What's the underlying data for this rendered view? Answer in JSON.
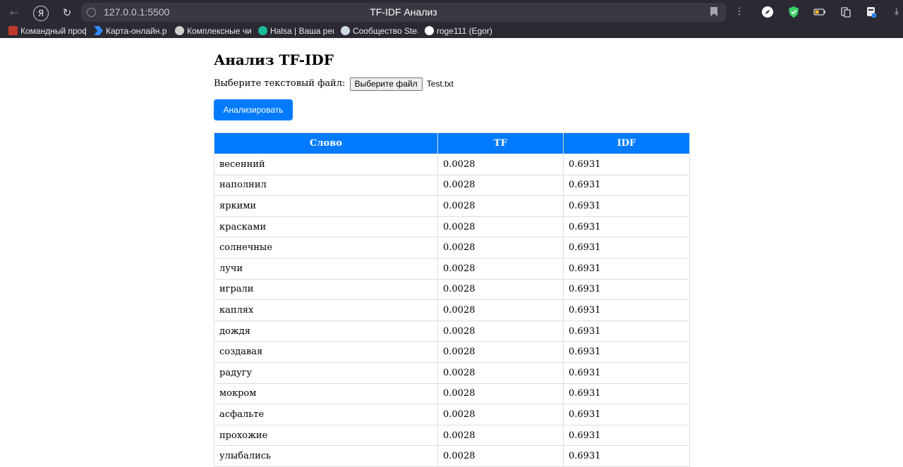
{
  "browser": {
    "url": "127.0.0.1:5500",
    "tab_title": "TF-IDF Анализ",
    "yandex_label": "Я",
    "bookmarks": [
      {
        "label": "Командный проф",
        "icon": "calendar-icon",
        "color": "#c0392b"
      },
      {
        "label": "Карта-онлайн.рф",
        "icon": "arrow-icon",
        "color": "#2f8cff"
      },
      {
        "label": "Комплексные чис",
        "icon": "flower-icon",
        "color": "#cfcfcf"
      },
      {
        "label": "Halsa | Ваша реко",
        "icon": "h-icon",
        "color": "#1abc9c"
      },
      {
        "label": "Сообщество Stea",
        "icon": "steam-icon",
        "color": "#cfd8e6"
      },
      {
        "label": "roge111 (Egor)",
        "icon": "github-icon",
        "color": "#ffffff"
      }
    ]
  },
  "page": {
    "title": "Анализ TF-IDF",
    "file_label": "Выберите текстовый файл:",
    "file_button": "Выберите файл",
    "file_name": "Test.txt",
    "analyze_button": "Анализировать",
    "table": {
      "headers": [
        "Слово",
        "TF",
        "IDF"
      ],
      "rows": [
        [
          "весенний",
          "0.0028",
          "0.6931"
        ],
        [
          "наполнил",
          "0.0028",
          "0.6931"
        ],
        [
          "яркими",
          "0.0028",
          "0.6931"
        ],
        [
          "красками",
          "0.0028",
          "0.6931"
        ],
        [
          "солнечные",
          "0.0028",
          "0.6931"
        ],
        [
          "лучи",
          "0.0028",
          "0.6931"
        ],
        [
          "играли",
          "0.0028",
          "0.6931"
        ],
        [
          "каплях",
          "0.0028",
          "0.6931"
        ],
        [
          "дождя",
          "0.0028",
          "0.6931"
        ],
        [
          "создавая",
          "0.0028",
          "0.6931"
        ],
        [
          "радугу",
          "0.0028",
          "0.6931"
        ],
        [
          "мокром",
          "0.0028",
          "0.6931"
        ],
        [
          "асфальте",
          "0.0028",
          "0.6931"
        ],
        [
          "прохожие",
          "0.0028",
          "0.6931"
        ],
        [
          "улыбались",
          "0.0028",
          "0.6931"
        ]
      ]
    }
  },
  "colors": {
    "accent": "#007bff",
    "chrome_bg": "#2b2a33"
  }
}
